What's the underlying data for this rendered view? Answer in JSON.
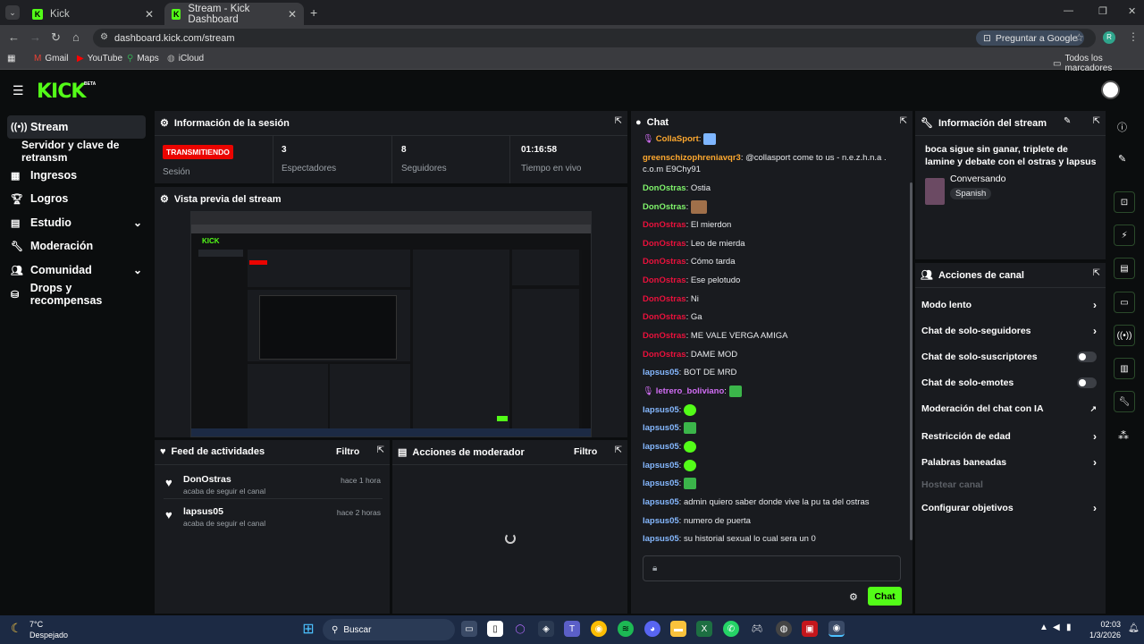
{
  "browser": {
    "tabs": [
      {
        "label": "Kick"
      },
      {
        "label": "Stream - Kick Dashboard"
      }
    ],
    "url": "dashboard.kick.com/stream",
    "ask_google": "Preguntar a Google",
    "profile_initial": "R",
    "bookmarks": [
      "Gmail",
      "YouTube",
      "Maps",
      "iCloud"
    ],
    "all_bookmarks": "Todos los marcadores"
  },
  "app": {
    "logo": "KICK",
    "beta": "BETA"
  },
  "sidebar": {
    "items": [
      {
        "label": "Stream"
      },
      {
        "label": "Servidor y clave de retransm"
      },
      {
        "label": "Ingresos"
      },
      {
        "label": "Logros"
      },
      {
        "label": "Estudio"
      },
      {
        "label": "Moderación"
      },
      {
        "label": "Comunidad"
      },
      {
        "label": "Drops y recompensas"
      }
    ]
  },
  "session": {
    "title": "Información de la sesión",
    "status": "TRANSMITIENDO",
    "status_label": "Sesión",
    "viewers": "3",
    "viewers_label": "Espectadores",
    "followers": "8",
    "followers_label": "Seguidores",
    "time": "01:16:58",
    "time_label": "Tiempo en vivo"
  },
  "preview": {
    "title": "Vista previa del stream"
  },
  "activity": {
    "title": "Feed de actividades",
    "filter": "Filtro",
    "items": [
      {
        "user": "DonOstras",
        "action": "acaba de seguir el canal",
        "time": "hace 1 hora"
      },
      {
        "user": "lapsus05",
        "action": "acaba de seguir el canal",
        "time": "hace 2 horas"
      }
    ]
  },
  "mod_actions": {
    "title": "Acciones de moderador",
    "filter": "Filtro"
  },
  "chat": {
    "title": "Chat",
    "messages": [
      {
        "user": "CollaSport",
        "text": ""
      },
      {
        "user": "greenschizophreniavqr3",
        "text": "@collasport come to us - n.e.z.h.n.a . c.o.m E9Chy91"
      },
      {
        "user": "DonOstras",
        "text": "Ostia"
      },
      {
        "user": "DonOstras",
        "text": ""
      },
      {
        "user": "DonOstras",
        "text": "El mierdon"
      },
      {
        "user": "DonOstras",
        "text": "Leo de mierda"
      },
      {
        "user": "DonOstras",
        "text": "Cómo tarda"
      },
      {
        "user": "DonOstras",
        "text": "Ese pelotudo"
      },
      {
        "user": "DonOstras",
        "text": "Ni"
      },
      {
        "user": "DonOstras",
        "text": "Ga"
      },
      {
        "user": "DonOstras",
        "text": "ME VALE VERGA AMIGA"
      },
      {
        "user": "DonOstras",
        "text": "DAME MOD"
      },
      {
        "user": "lapsus05",
        "text": "BOT DE MRD"
      },
      {
        "user": "letrero_boliviano",
        "text": ""
      },
      {
        "user": "lapsus05",
        "text": ""
      },
      {
        "user": "lapsus05",
        "text": ""
      },
      {
        "user": "lapsus05",
        "text": ""
      },
      {
        "user": "lapsus05",
        "text": ""
      },
      {
        "user": "lapsus05",
        "text": ""
      },
      {
        "user": "lapsus05",
        "text": "admin quiero saber donde vive la pu ta del ostras"
      },
      {
        "user": "lapsus05",
        "text": "numero de puerta"
      },
      {
        "user": "lapsus05",
        "text": "su historial sexual lo cual sera un 0"
      }
    ],
    "send": "Chat"
  },
  "stream_info": {
    "title": "Información del stream",
    "stream_title": "boca sigue sin ganar, triplete de lamine y debate con el ostras y lapsus",
    "category": "Conversando",
    "language": "Spanish"
  },
  "channel_actions": {
    "title": "Acciones de canal",
    "items": [
      {
        "label": "Modo lento"
      },
      {
        "label": "Chat de solo-seguidores"
      },
      {
        "label": "Chat de solo-suscriptores"
      },
      {
        "label": "Chat de solo-emotes"
      },
      {
        "label": "Moderación del chat con IA"
      },
      {
        "label": "Restricción de edad"
      },
      {
        "label": "Palabras baneadas"
      },
      {
        "label": "Hostear canal"
      },
      {
        "label": "Configurar objetivos"
      }
    ]
  },
  "taskbar": {
    "temp": "7°C",
    "weather": "Despejado",
    "search": "Buscar",
    "time": "02:03",
    "date": "1/3/2026"
  }
}
